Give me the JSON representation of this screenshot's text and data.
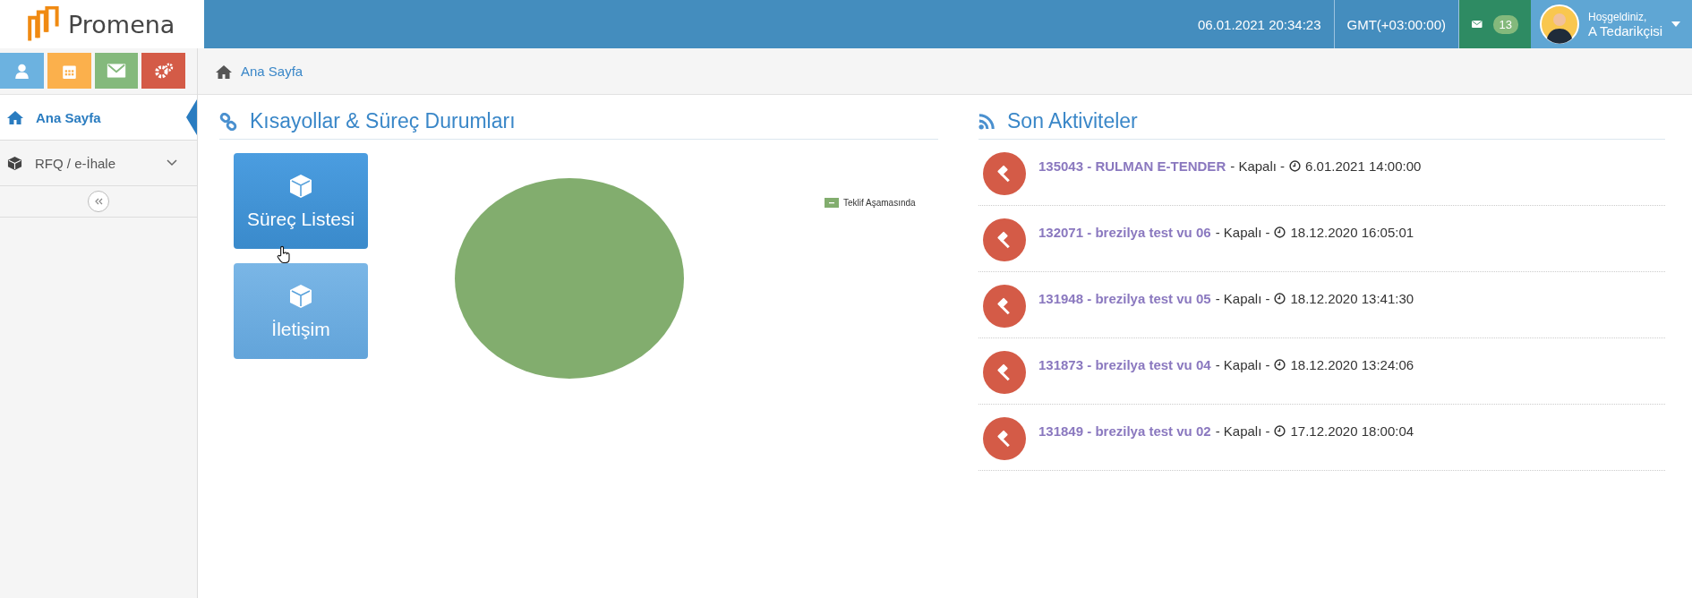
{
  "brand": {
    "name": "Promena"
  },
  "header": {
    "datetime": "06.01.2021 20:34:23",
    "timezone": "GMT(+03:00:00)",
    "messages_count": "13",
    "greeting": "Hoşgeldiniz,",
    "user_name": "A Tedarikçisi"
  },
  "quick_buttons": [
    {
      "kind": "user",
      "color": "#6cb2e0"
    },
    {
      "kind": "calendar",
      "color": "#fbb04c"
    },
    {
      "kind": "mail",
      "color": "#84b97c"
    },
    {
      "kind": "gears",
      "color": "#d45b47"
    }
  ],
  "sidebar": {
    "items": [
      {
        "label": "Ana Sayfa",
        "selected": true,
        "expandable": false
      },
      {
        "label": "RFQ / e-İhale",
        "selected": false,
        "expandable": true
      }
    ]
  },
  "breadcrumb": [
    "Ana Sayfa"
  ],
  "shortcuts": {
    "title": "Kısayollar & Süreç Durumları",
    "tiles": [
      {
        "label": "Süreç Listesi",
        "hovered": true
      },
      {
        "label": "İletişim",
        "hovered": false
      }
    ],
    "pie_legend": [
      {
        "label": "Teklif Aşamasında",
        "color": "#82ad6e"
      }
    ]
  },
  "activities": {
    "title": "Son Aktiviteler",
    "items": [
      {
        "link": "135043 - RULMAN E-TENDER",
        "status": "- Kapalı -",
        "date": "6.01.2021 14:00:00"
      },
      {
        "link": "132071 - brezilya test vu 06",
        "status": "- Kapalı -",
        "date": "18.12.2020 16:05:01"
      },
      {
        "link": "131948 - brezilya test vu 05",
        "status": "- Kapalı -",
        "date": "18.12.2020 13:41:30"
      },
      {
        "link": "131873 - brezilya test vu 04",
        "status": "- Kapalı -",
        "date": "18.12.2020 13:24:06"
      },
      {
        "link": "131849 - brezilya test vu 02",
        "status": "- Kapalı -",
        "date": "17.12.2020 18:00:04"
      }
    ]
  }
}
